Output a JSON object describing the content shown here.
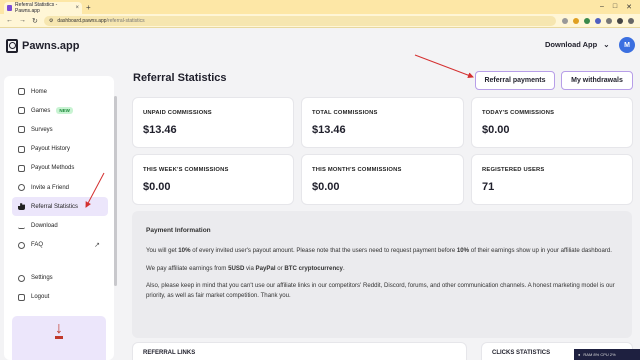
{
  "browser": {
    "tab_title": "Referral Statistics - Pawns.app",
    "tab_close": "×",
    "new_tab": "+",
    "url_domain": "dashboard.pawns.app",
    "url_path": "/referral-statistics",
    "win_min": "–",
    "win_max": "□",
    "win_close": "✕"
  },
  "header": {
    "logo_text": "Pawns.app",
    "download_app": "Download App",
    "chevron": "⌄",
    "avatar_initial": "M"
  },
  "sidebar": {
    "items": [
      {
        "label": "Home"
      },
      {
        "label": "Games",
        "badge": "NEW"
      },
      {
        "label": "Surveys"
      },
      {
        "label": "Payout History"
      },
      {
        "label": "Payout Methods"
      },
      {
        "label": "Invite a Friend"
      },
      {
        "label": "Referral Statistics"
      },
      {
        "label": "Download"
      },
      {
        "label": "FAQ",
        "ext": "↗"
      }
    ],
    "bottom_items": [
      {
        "label": "Settings"
      },
      {
        "label": "Logout"
      }
    ],
    "download_arrow": "↓"
  },
  "main": {
    "title": "Referral Statistics",
    "btn_referral_payments": "Referral payments",
    "btn_my_withdrawals": "My withdrawals",
    "stats": [
      {
        "label": "UNPAID COMMISSIONS",
        "value": "$13.46"
      },
      {
        "label": "TOTAL COMMISSIONS",
        "value": "$13.46"
      },
      {
        "label": "TODAY'S COMMISSIONS",
        "value": "$0.00"
      },
      {
        "label": "THIS WEEK'S COMMISSIONS",
        "value": "$0.00"
      },
      {
        "label": "THIS MONTH'S COMMISSIONS",
        "value": "$0.00"
      },
      {
        "label": "REGISTERED USERS",
        "value": "71"
      }
    ],
    "info": {
      "title": "Payment Information",
      "p1_a": "You will get ",
      "p1_b": "10%",
      "p1_c": " of every invited user's payout amount. Please note that the users need to request payment before ",
      "p1_d": "10%",
      "p1_e": " of their earnings show up in your affiliate dashboard.",
      "p2_a": "We pay affiliate earnings from ",
      "p2_b": "5USD",
      "p2_c": " via ",
      "p2_d": "PayPal",
      "p2_e": " or ",
      "p2_f": "BTC cryptocurrency",
      "p2_g": ".",
      "p3": "Also, please keep in mind that you can't use our affiliate links in our competitors' Reddit, Discord, forums, and other communication channels. A honest marketing model is our priority, as well as fair market competition. Thank you."
    },
    "referral_links_title": "REFERRAL LINKS",
    "clicks_statistics_title": "CLICKS STATISTICS"
  },
  "taskbar": {
    "text": "RAM 8% CPU 2%"
  },
  "colors": {
    "accent": "#b79ee8",
    "active_nav": "#ece6fb",
    "annotation_arrow": "#d43030",
    "avatar": "#3b6fe0"
  }
}
